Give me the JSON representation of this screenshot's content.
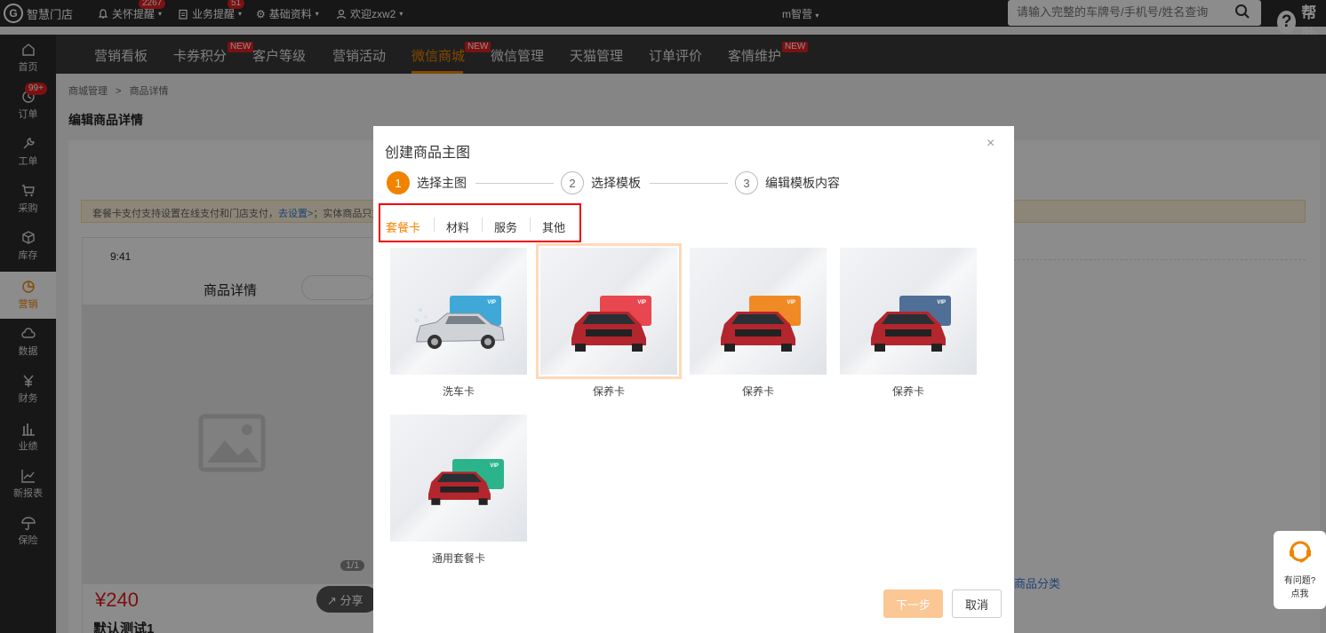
{
  "topbar": {
    "logo_text": "智慧门店",
    "nav": [
      {
        "label": "关怀提醒",
        "badge": "2267",
        "icon": "bell-icon"
      },
      {
        "label": "业务提醒",
        "badge": "51",
        "icon": "clipboard-icon"
      },
      {
        "label": "基础资料",
        "badge": "",
        "icon": "gear-icon"
      },
      {
        "label": "欢迎zxw2",
        "badge": "",
        "icon": "user-icon"
      }
    ],
    "center_user": "m智营",
    "search_placeholder": "请输入完整的车牌号/手机号/姓名查询",
    "help_label": "帮助"
  },
  "sidebar": {
    "items": [
      {
        "label": "首页",
        "icon": "home-icon"
      },
      {
        "label": "订单",
        "icon": "order-icon",
        "badge": "99+"
      },
      {
        "label": "工单",
        "icon": "wrench-icon"
      },
      {
        "label": "采购",
        "icon": "cart-icon"
      },
      {
        "label": "库存",
        "icon": "box-icon"
      },
      {
        "label": "营销",
        "icon": "pie-icon"
      },
      {
        "label": "数据",
        "icon": "cloud-icon"
      },
      {
        "label": "财务",
        "icon": "yen-icon"
      },
      {
        "label": "业绩",
        "icon": "bar-chart-icon"
      },
      {
        "label": "新报表",
        "icon": "line-chart-icon"
      },
      {
        "label": "保险",
        "icon": "umbrella-icon"
      }
    ]
  },
  "nav2": {
    "items": [
      "营销看板",
      "卡券积分",
      "客户等级",
      "营销活动",
      "微信商城",
      "微信管理",
      "天猫管理",
      "订单评价",
      "客情维护"
    ],
    "new_tag": "NEW"
  },
  "page": {
    "breadcrumb_root": "商城管理",
    "breadcrumb_sep": ">",
    "breadcrumb_current": "商品详情",
    "title": "编辑商品详情",
    "notice_text": "套餐卡支付支持设置在线支付和门店支付，",
    "notice_link": "去设置>",
    "notice_tail": "；实体商品只支",
    "phone_time": "9:41",
    "phone_title": "商品详情",
    "pager": "1/1",
    "price": "¥240",
    "share": "分享",
    "product_name": "默认测试1",
    "category_link": "商品分类"
  },
  "modal": {
    "title": "创建商品主图",
    "close": "×",
    "steps": [
      {
        "num": "1",
        "label": "选择主图"
      },
      {
        "num": "2",
        "label": "选择模板"
      },
      {
        "num": "3",
        "label": "编辑模板内容"
      }
    ],
    "tabs": [
      "套餐卡",
      "材料",
      "服务",
      "其他"
    ],
    "cards": [
      {
        "label": "洗车卡",
        "vip_color": "#3fa8d8",
        "car": "silver",
        "vip_text": "VIP"
      },
      {
        "label": "保养卡",
        "vip_color": "#e8474f",
        "car": "red",
        "vip_text": "VIP"
      },
      {
        "label": "保养卡",
        "vip_color": "#f08a24",
        "car": "red",
        "vip_text": "VIP"
      },
      {
        "label": "保养卡",
        "vip_color": "#4f6f97",
        "car": "red",
        "vip_text": "VIP"
      },
      {
        "label": "通用套餐卡",
        "vip_color": "#2bb48c",
        "car": "red",
        "vip_text": "VIP"
      }
    ],
    "next_button": "下一步",
    "cancel_button": "取消"
  },
  "help_widget": {
    "line1": "有问题?",
    "line2": "点我"
  }
}
